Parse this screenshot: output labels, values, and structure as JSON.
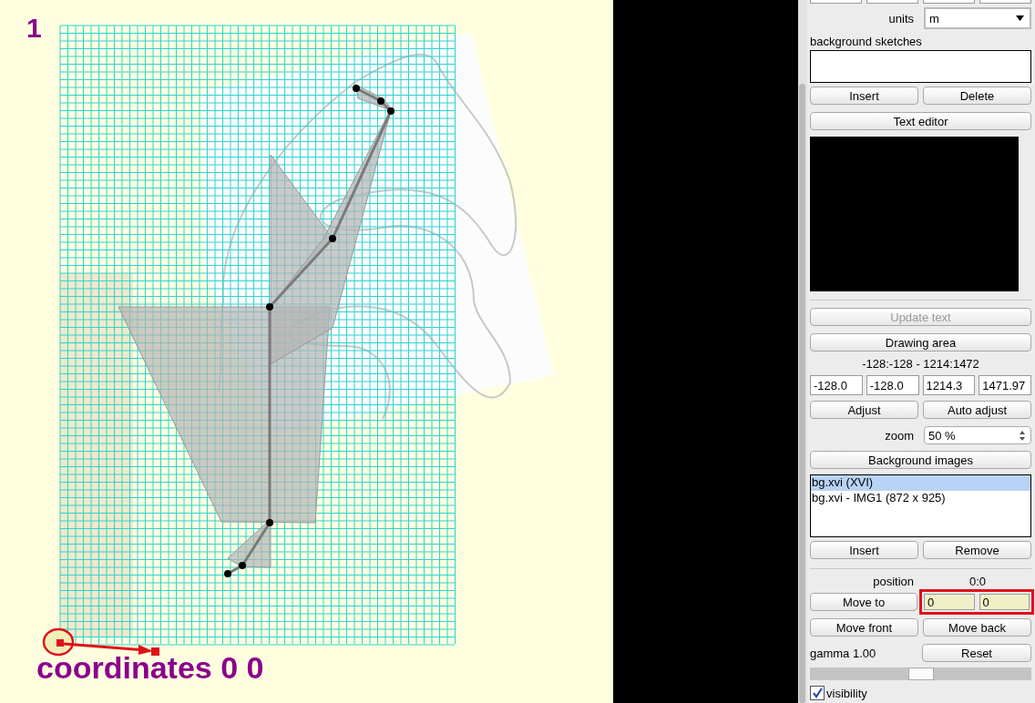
{
  "canvas": {
    "page_number": "1",
    "caption": "coordinates 0 0"
  },
  "panel": {
    "units": {
      "label": "units",
      "value": "m"
    },
    "sketches": {
      "label": "background sketches",
      "buttons": [
        {
          "label": "Insert"
        },
        {
          "label": "Delete"
        }
      ]
    },
    "text_editor": {
      "label": "Text editor"
    },
    "update_text": {
      "label": "Update text",
      "disabled": true
    },
    "drawing_area": {
      "label": "Drawing area",
      "disabled": false,
      "readout": "-128:-128 - 1214:1472",
      "fields": [
        "-128.0",
        "-128.0",
        "1214.3",
        "1471.97"
      ],
      "buttons": [
        {
          "label": "Adjust"
        },
        {
          "label": "Auto adjust"
        }
      ]
    },
    "zoom": {
      "label": "zoom",
      "value": "50 %"
    },
    "background_images": {
      "label": "Background images",
      "items": [
        {
          "label": "bg.xvi (XVI)",
          "selected": true
        },
        {
          "label": "bg.xvi - IMG1 (872 x 925)",
          "selected": false
        }
      ],
      "buttons": [
        {
          "label": "Insert"
        },
        {
          "label": "Remove"
        }
      ]
    },
    "position": {
      "label": "position",
      "value": "0:0",
      "highlighted": true,
      "fields": [
        "0",
        "0"
      ],
      "move_to": "Move to"
    },
    "order_buttons": [
      {
        "label": "Move front"
      },
      {
        "label": "Move back"
      }
    ],
    "gamma": {
      "label": "gamma 1.00",
      "reset": "Reset",
      "level": 0.5
    },
    "visibility": {
      "label": "visibility",
      "checked": true
    }
  }
}
